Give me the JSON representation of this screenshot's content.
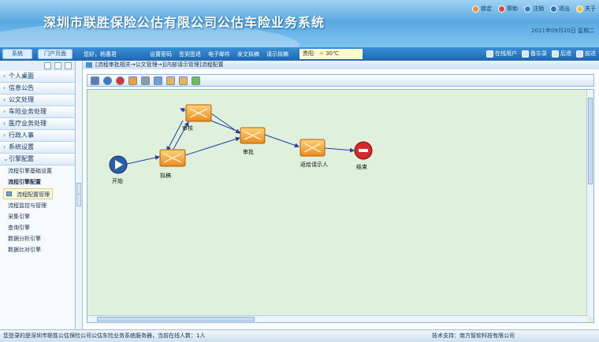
{
  "header": {
    "title": "深圳市联胜保险公估有限公司公估车险业务系统",
    "links": [
      "锁定",
      "帮助",
      "注销",
      "退出",
      "关于"
    ],
    "date": "2011年09月20日 星期二"
  },
  "toolbar": {
    "left_btn1": "系统",
    "left_btn2": "门户页面",
    "greeting": "您好，杨惠君",
    "nav": [
      "设置密码",
      "签到签退",
      "电子邮件",
      "发文拟稿",
      "请示拟稿"
    ],
    "weather_city": "贵阳",
    "weather_temp": "30℃",
    "right": [
      "在线用户",
      "备忘录",
      "后退",
      "前进"
    ]
  },
  "sidebar": {
    "sections": [
      "个人桌面",
      "信息公告",
      "公文处理",
      "车险业务处理",
      "医疗业务处理",
      "行政人事",
      "系统设置",
      "引擎配置"
    ],
    "engine_items": [
      "流程引擎基础设置",
      "流程引擎配置",
      "流程配置管理",
      "流程监控与管理",
      "采集引擎",
      "查询引擎",
      "数据分析引擎",
      "数据比对引擎"
    ]
  },
  "main": {
    "breadcrumb": "[流程审批相关→公文管理→][内部请示管理]流程配置"
  },
  "workflow": {
    "nodes": {
      "start": "开始",
      "draft": "拟稿",
      "review1": "审核",
      "approve": "审批",
      "feedback": "返给请示人",
      "end": "结束"
    }
  },
  "status": {
    "left": "您登录的是深圳市联胜公估保险公司公估车险业务系统服务器，当前在线人数：1人",
    "right": "技术支持：南方智软科技有限公司"
  },
  "colors": {
    "accent": "#1d67b3",
    "canvas": "#dff1dc",
    "task": "#f0a030",
    "end": "#d42a2a",
    "start": "#2b5fa8"
  }
}
